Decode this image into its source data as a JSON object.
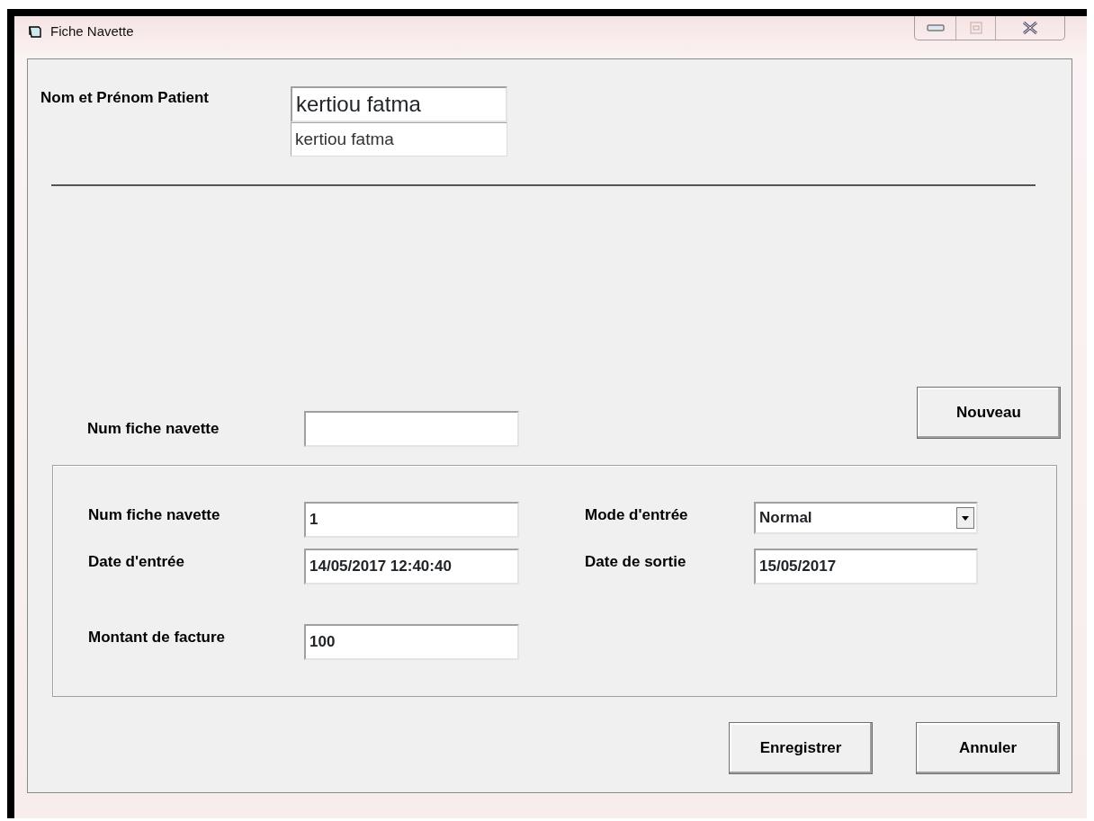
{
  "window": {
    "title": "Fiche Navette"
  },
  "patient": {
    "label": "Nom et Prénom Patient",
    "name_display": "kertiou fatma",
    "name_field": "kertiou fatma"
  },
  "search": {
    "label": "Num fiche navette"
  },
  "new_button": "Nouveau",
  "details": {
    "left": [
      {
        "label": "Num fiche navette",
        "value": "1",
        "kind": "text"
      },
      {
        "label": "Date d'entrée",
        "value": "14/05/2017 12:40:40",
        "kind": "text"
      },
      {
        "label": "Montant de facture",
        "value": "100",
        "kind": "text"
      }
    ],
    "right": [
      {
        "label": "Mode d'entrée",
        "value": "Normal",
        "kind": "select"
      },
      {
        "label": "Date de sortie",
        "value": "15/05/2017",
        "kind": "text"
      }
    ]
  },
  "buttons": [
    "Enregistrer",
    "Annuler"
  ]
}
